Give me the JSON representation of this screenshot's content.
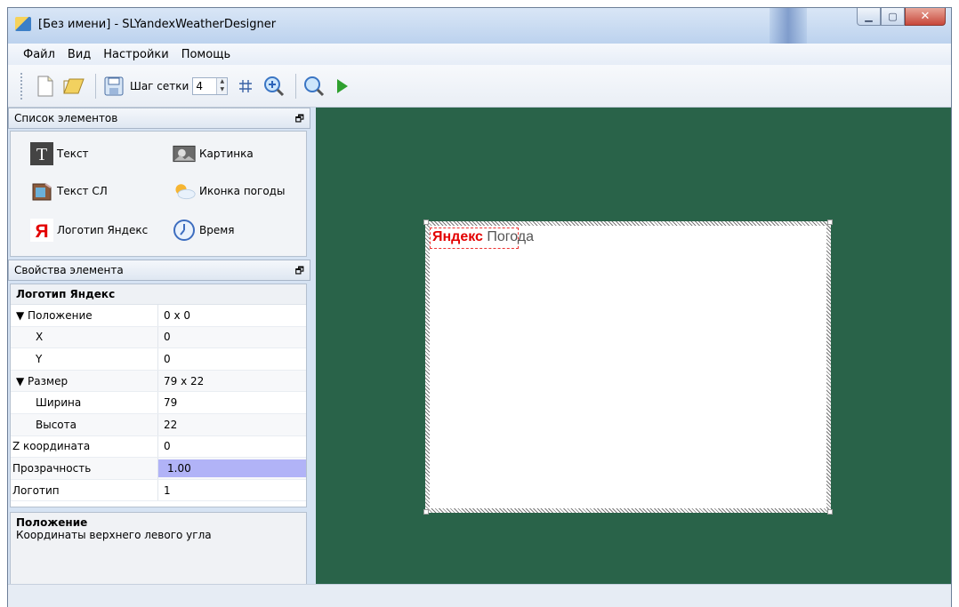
{
  "window": {
    "title": "[Без имени] - SLYandexWeatherDesigner"
  },
  "menu": {
    "items": [
      "Файл",
      "Вид",
      "Настройки",
      "Помощь"
    ]
  },
  "toolbar": {
    "grid_label": "Шаг сетки",
    "grid_value": "4"
  },
  "elements_panel": {
    "title": "Список элементов",
    "items": [
      {
        "label": "Текст",
        "icon": "text-icon"
      },
      {
        "label": "Картинка",
        "icon": "image-icon"
      },
      {
        "label": "Текст СЛ",
        "icon": "text-sl-icon"
      },
      {
        "label": "Иконка погоды",
        "icon": "weather-icon"
      },
      {
        "label": "Логотип Яндекс",
        "icon": "yandex-logo-icon"
      },
      {
        "label": "Время",
        "icon": "clock-icon"
      }
    ]
  },
  "properties_panel": {
    "title": "Свойства элемента",
    "object_name": "Логотип Яндекс",
    "rows": [
      {
        "key": "▼ Положение",
        "value": "0 x 0"
      },
      {
        "key": "X",
        "value": "0"
      },
      {
        "key": "Y",
        "value": "0"
      },
      {
        "key": "▼ Размер",
        "value": "79 x 22"
      },
      {
        "key": "Ширина",
        "value": "79"
      },
      {
        "key": "Высота",
        "value": "22"
      },
      {
        "key": "Z координата",
        "value": "0"
      },
      {
        "key": "Прозрачность",
        "value": "1.00"
      },
      {
        "key": "Логотип",
        "value": "1"
      }
    ]
  },
  "description": {
    "title": "Положение",
    "text": "Координаты верхнего левого угла"
  },
  "canvas": {
    "logo_y": "Яндекс",
    "logo_p": "Погода",
    "background": "#296349"
  }
}
